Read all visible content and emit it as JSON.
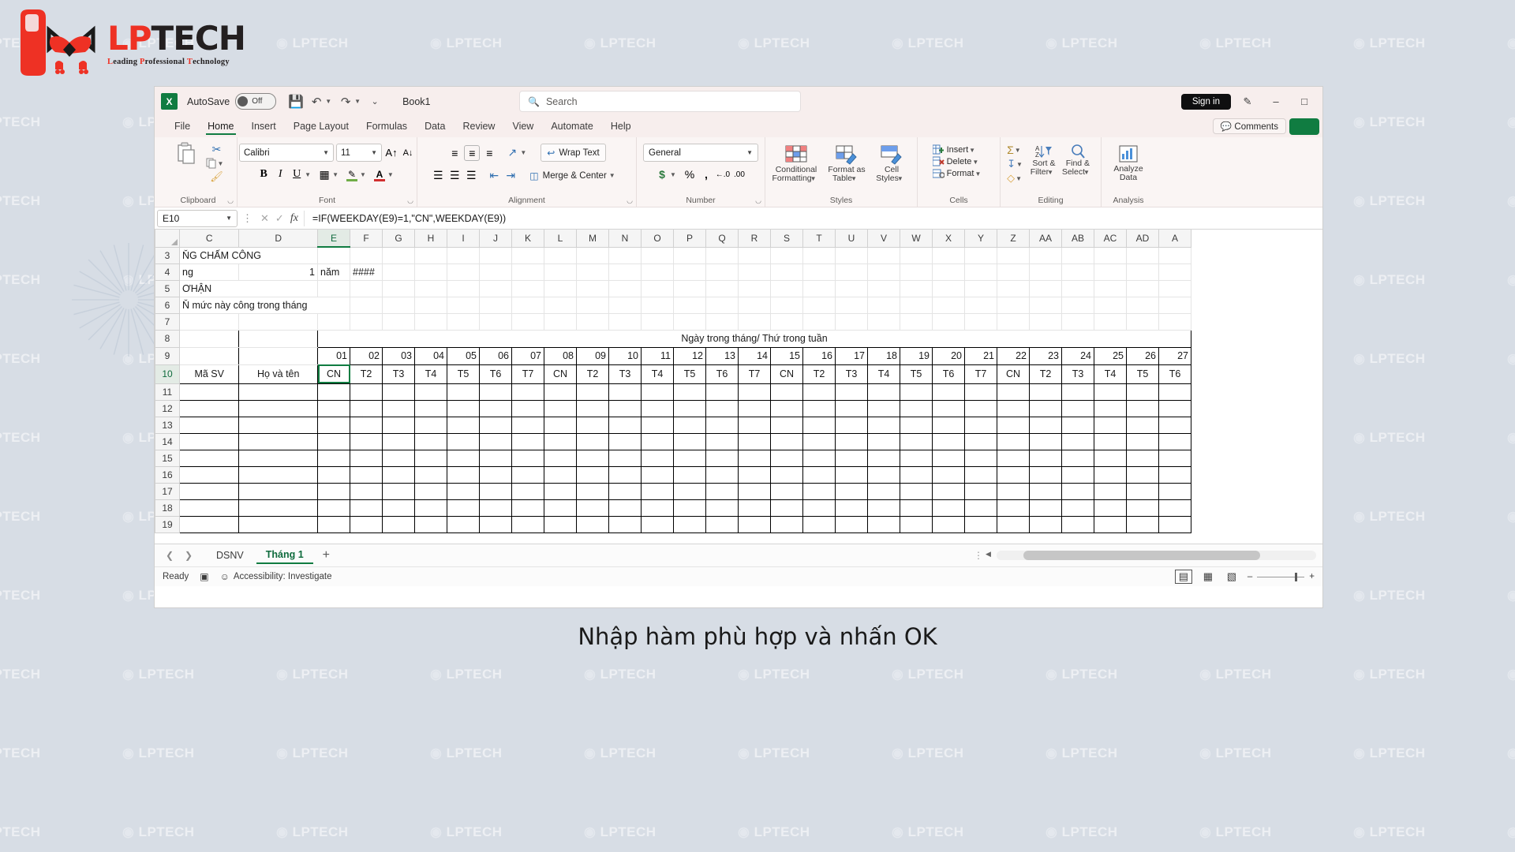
{
  "logo": {
    "main_lp": "LP",
    "main_tech": "TECH",
    "tagline_l": "L",
    "tagline_1": "eading ",
    "tagline_p": "P",
    "tagline_2": "rofessional ",
    "tagline_t": "T",
    "tagline_3": "echnology"
  },
  "watermark_text": "LPTECH",
  "titlebar": {
    "app_icon": "excel-icon",
    "autosave_label": "AutoSave",
    "autosave_state": "Off",
    "save_icon": "save-icon",
    "undo_icon": "undo-icon",
    "redo_icon": "redo-icon",
    "more_icon": "more-commands-icon",
    "document_name": "Book1",
    "search_placeholder": "Search",
    "sign_in": "Sign in",
    "pen_icon": "pen-icon",
    "minimize": "–",
    "restore": "□"
  },
  "ribbon_tabs": [
    {
      "label": "File",
      "active": false
    },
    {
      "label": "Home",
      "active": true
    },
    {
      "label": "Insert",
      "active": false
    },
    {
      "label": "Page Layout",
      "active": false
    },
    {
      "label": "Formulas",
      "active": false
    },
    {
      "label": "Data",
      "active": false
    },
    {
      "label": "Review",
      "active": false
    },
    {
      "label": "View",
      "active": false
    },
    {
      "label": "Automate",
      "active": false
    },
    {
      "label": "Help",
      "active": false
    }
  ],
  "comments_label": "Comments",
  "ribbon": {
    "clipboard": {
      "group_label": "Clipboard",
      "paste_label": "Paste",
      "cut_icon": "scissors-icon",
      "copy_icon": "copy-icon",
      "format_painter_icon": "format-painter-icon"
    },
    "font": {
      "group_label": "Font",
      "font_name": "Calibri",
      "font_size": "11",
      "grow_font": "A",
      "shrink_font": "A",
      "bold": "B",
      "italic": "I",
      "underline": "U",
      "borders_icon": "borders-icon",
      "fill_color_icon": "fill-color-icon",
      "font_color_icon": "font-color-icon"
    },
    "alignment": {
      "group_label": "Alignment",
      "align_top_icon": "align-top-icon",
      "align_middle_icon": "align-middle-icon",
      "align_bottom_icon": "align-bottom-icon",
      "orientation_icon": "orientation-icon",
      "align_left_icon": "align-left-icon",
      "align_center_icon": "align-center-icon",
      "align_right_icon": "align-right-icon",
      "decrease_indent_icon": "decrease-indent-icon",
      "increase_indent_icon": "increase-indent-icon",
      "wrap_text": "Wrap Text",
      "merge_center": "Merge & Center"
    },
    "number": {
      "group_label": "Number",
      "format": "General",
      "currency": "$",
      "percent": "%",
      "comma": ",",
      "increase_decimal_icon": "increase-decimal-icon",
      "decrease_decimal_icon": "decrease-decimal-icon"
    },
    "styles": {
      "group_label": "Styles",
      "conditional_formatting": "Conditional\nFormatting",
      "conditional_l1": "Conditional",
      "conditional_l2": "Formatting",
      "format_as_table_l1": "Format as",
      "format_as_table_l2": "Table",
      "cell_styles_l1": "Cell",
      "cell_styles_l2": "Styles"
    },
    "cells": {
      "group_label": "Cells",
      "insert": "Insert",
      "delete": "Delete",
      "format": "Format"
    },
    "editing": {
      "group_label": "Editing",
      "autosum_icon": "autosum-icon",
      "fill_icon": "fill-icon",
      "clear_icon": "clear-icon",
      "sort_filter_l1": "Sort &",
      "sort_filter_l2": "Filter",
      "find_select_l1": "Find &",
      "find_select_l2": "Select"
    },
    "analysis": {
      "group_label": "Analysis",
      "analyze_l1": "Analyze",
      "analyze_l2": "Data"
    }
  },
  "formula_bar": {
    "name_box": "E10",
    "cancel_icon": "cancel-icon",
    "enter_icon": "confirm-icon",
    "function_icon": "insert-function-icon",
    "formula": "=IF(WEEKDAY(E9)=1,\"CN\",WEEKDAY(E9))"
  },
  "grid": {
    "columns": [
      "C",
      "D",
      "E",
      "F",
      "G",
      "H",
      "I",
      "J",
      "K",
      "L",
      "M",
      "N",
      "O",
      "P",
      "Q",
      "R",
      "S",
      "T",
      "U",
      "V",
      "W",
      "X",
      "Y",
      "Z",
      "AA",
      "AB",
      "AC",
      "AD",
      "A"
    ],
    "selected_column": "E",
    "selected_cell": "E10",
    "rows": [
      "3",
      "4",
      "5",
      "6",
      "7",
      "8",
      "9",
      "10",
      "11",
      "12",
      "13",
      "14",
      "15",
      "16",
      "17",
      "18",
      "19"
    ],
    "row3": {
      "C": "ŇG CHẤM CÔNG"
    },
    "row4": {
      "C": "ng",
      "D": "1",
      "E": "năm",
      "F": "####"
    },
    "row5": {
      "C": "ƠHẬN"
    },
    "row6": {
      "C": "Ň mức này công trong tháng"
    },
    "row8_merged_title": "Ngày trong tháng/ Thứ trong tuần",
    "row10_headers": {
      "C": "Mã SV",
      "D": "Họ và tên"
    },
    "day_numbers": [
      "01",
      "02",
      "03",
      "04",
      "05",
      "06",
      "07",
      "08",
      "09",
      "10",
      "11",
      "12",
      "13",
      "14",
      "15",
      "16",
      "17",
      "18",
      "19",
      "20",
      "21",
      "22",
      "23",
      "24",
      "25",
      "26",
      "27"
    ],
    "weekdays": [
      "CN",
      "T2",
      "T3",
      "T4",
      "T5",
      "T6",
      "T7",
      "CN",
      "T2",
      "T3",
      "T4",
      "T5",
      "T6",
      "T7",
      "CN",
      "T2",
      "T3",
      "T4",
      "T5",
      "T6",
      "T7",
      "CN",
      "T2",
      "T3",
      "T4",
      "T5",
      "T6"
    ]
  },
  "sheet_tabs": {
    "prev_icon": "previous-sheet-icon",
    "next_icon": "next-sheet-icon",
    "tabs": [
      {
        "label": "DSNV",
        "active": false
      },
      {
        "label": "Tháng 1",
        "active": true
      }
    ],
    "add_sheet": "+"
  },
  "status_bar": {
    "status": "Ready",
    "recording_icon": "macro-record-icon",
    "accessibility_icon": "accessibility-icon",
    "accessibility": "Accessibility: Investigate",
    "normal_view_icon": "normal-view-icon",
    "page_layout_icon": "page-layout-icon",
    "page_break_icon": "page-break-icon",
    "zoom_out": "–",
    "zoom_in": "+"
  },
  "caption": "Nhập hàm phù hợp và nhấn OK"
}
